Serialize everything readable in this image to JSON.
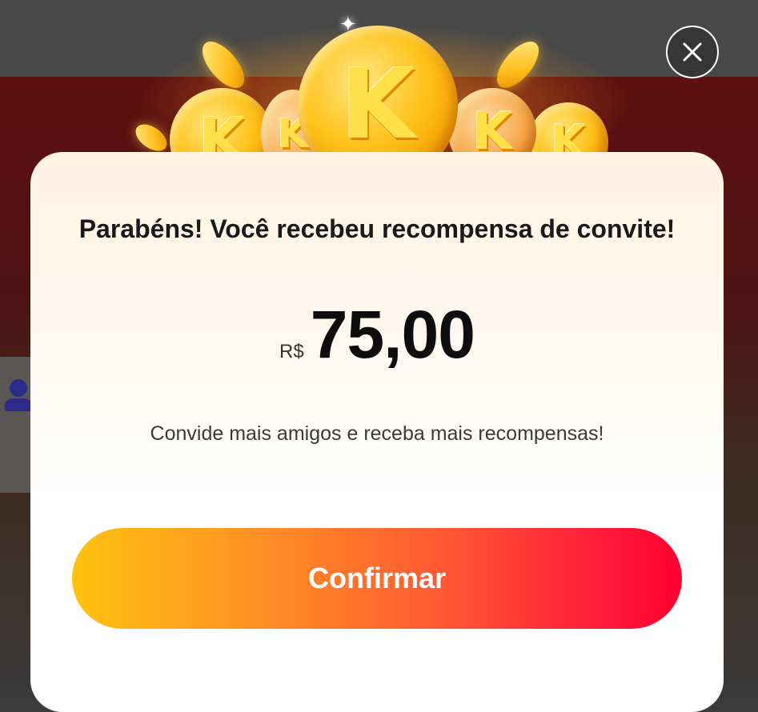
{
  "modal": {
    "title": "Parabéns! Você recebeu recompensa de convite!",
    "currency": "R$",
    "amount": "75,00",
    "subtitle": "Convide mais amigos e receba mais recompensas!",
    "confirm_label": "Confirmar"
  },
  "header": {
    "coin_letter": "K"
  },
  "icons": {
    "close": "close-icon",
    "coin": "coin-icon",
    "avatar": "user-icon"
  },
  "colors": {
    "button_start": "#ffc20e",
    "button_end": "#ff0030",
    "coin_gold": "#ffc21a",
    "overlay": "#3c3c3c"
  }
}
